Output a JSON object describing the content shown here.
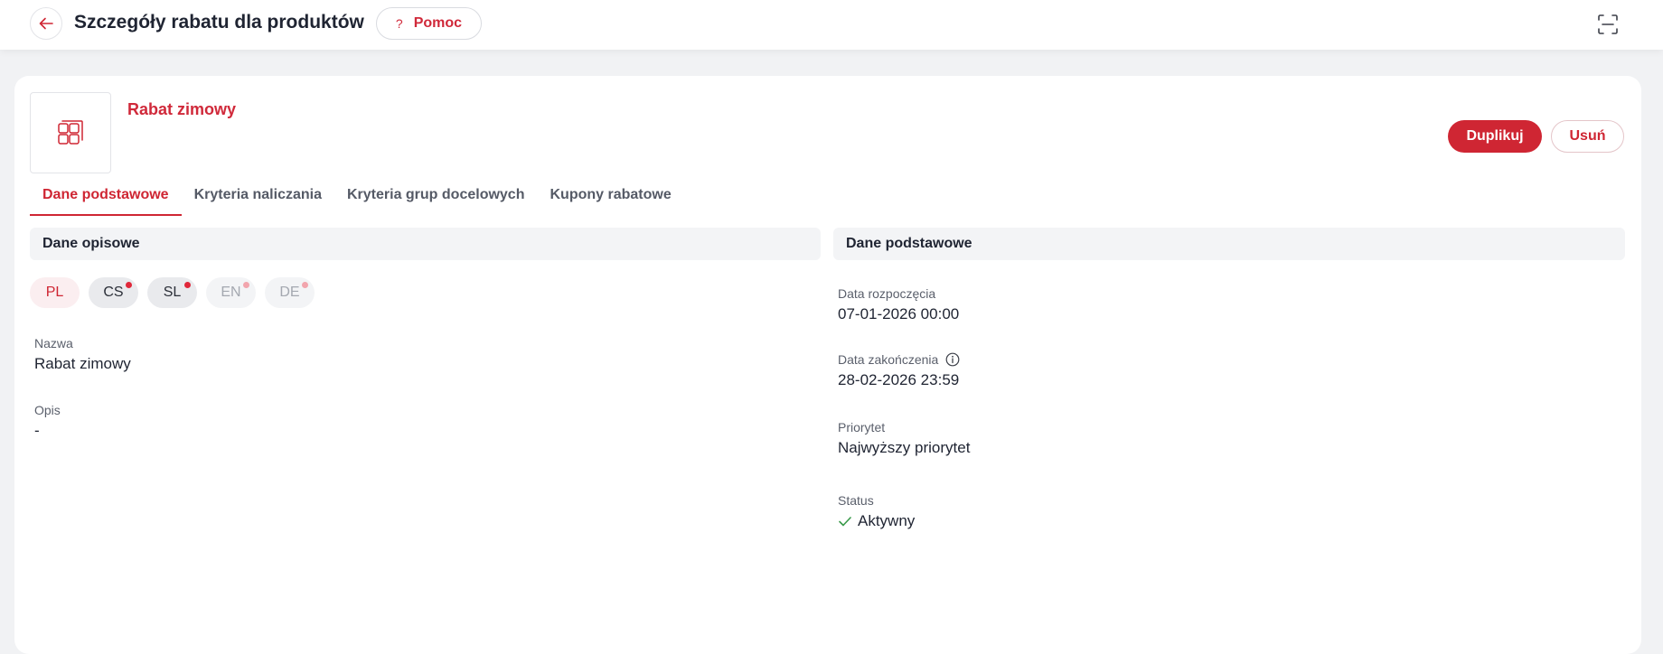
{
  "header": {
    "title": "Szczegóły rabatu dla produktów",
    "help_label": "Pomoc",
    "help_glyph": "?"
  },
  "discount": {
    "name": "Rabat zimowy"
  },
  "actions": {
    "duplicate_label": "Duplikuj",
    "delete_label": "Usuń"
  },
  "tabs": [
    {
      "label": "Dane podstawowe",
      "active": true
    },
    {
      "label": "Kryteria naliczania",
      "active": false
    },
    {
      "label": "Kryteria grup docelowych",
      "active": false
    },
    {
      "label": "Kupony rabatowe",
      "active": false
    }
  ],
  "descriptive": {
    "title": "Dane opisowe",
    "languages": [
      {
        "code": "PL",
        "state": "active"
      },
      {
        "code": "CS",
        "state": "filled-missing"
      },
      {
        "code": "SL",
        "state": "filled-missing"
      },
      {
        "code": "EN",
        "state": "disabled-missing"
      },
      {
        "code": "DE",
        "state": "disabled-missing"
      }
    ],
    "name_label": "Nazwa",
    "name_value": "Rabat zimowy",
    "desc_label": "Opis",
    "desc_value": "-"
  },
  "basic": {
    "title": "Dane podstawowe",
    "start_label": "Data rozpoczęcia",
    "start_value": "07-01-2026 00:00",
    "end_label": "Data zakończenia",
    "end_value": "28-02-2026 23:59",
    "priority_label": "Priorytet",
    "priority_value": "Najwyższy priorytet",
    "status_label": "Status",
    "status_value": "Aktywny"
  },
  "colors": {
    "accent": "#cf2633",
    "status_ok": "#3a9a4a"
  },
  "icons": [
    "back-arrow-icon",
    "help-icon",
    "fullscreen-icon",
    "product-grid-icon",
    "info-icon",
    "check-icon"
  ]
}
